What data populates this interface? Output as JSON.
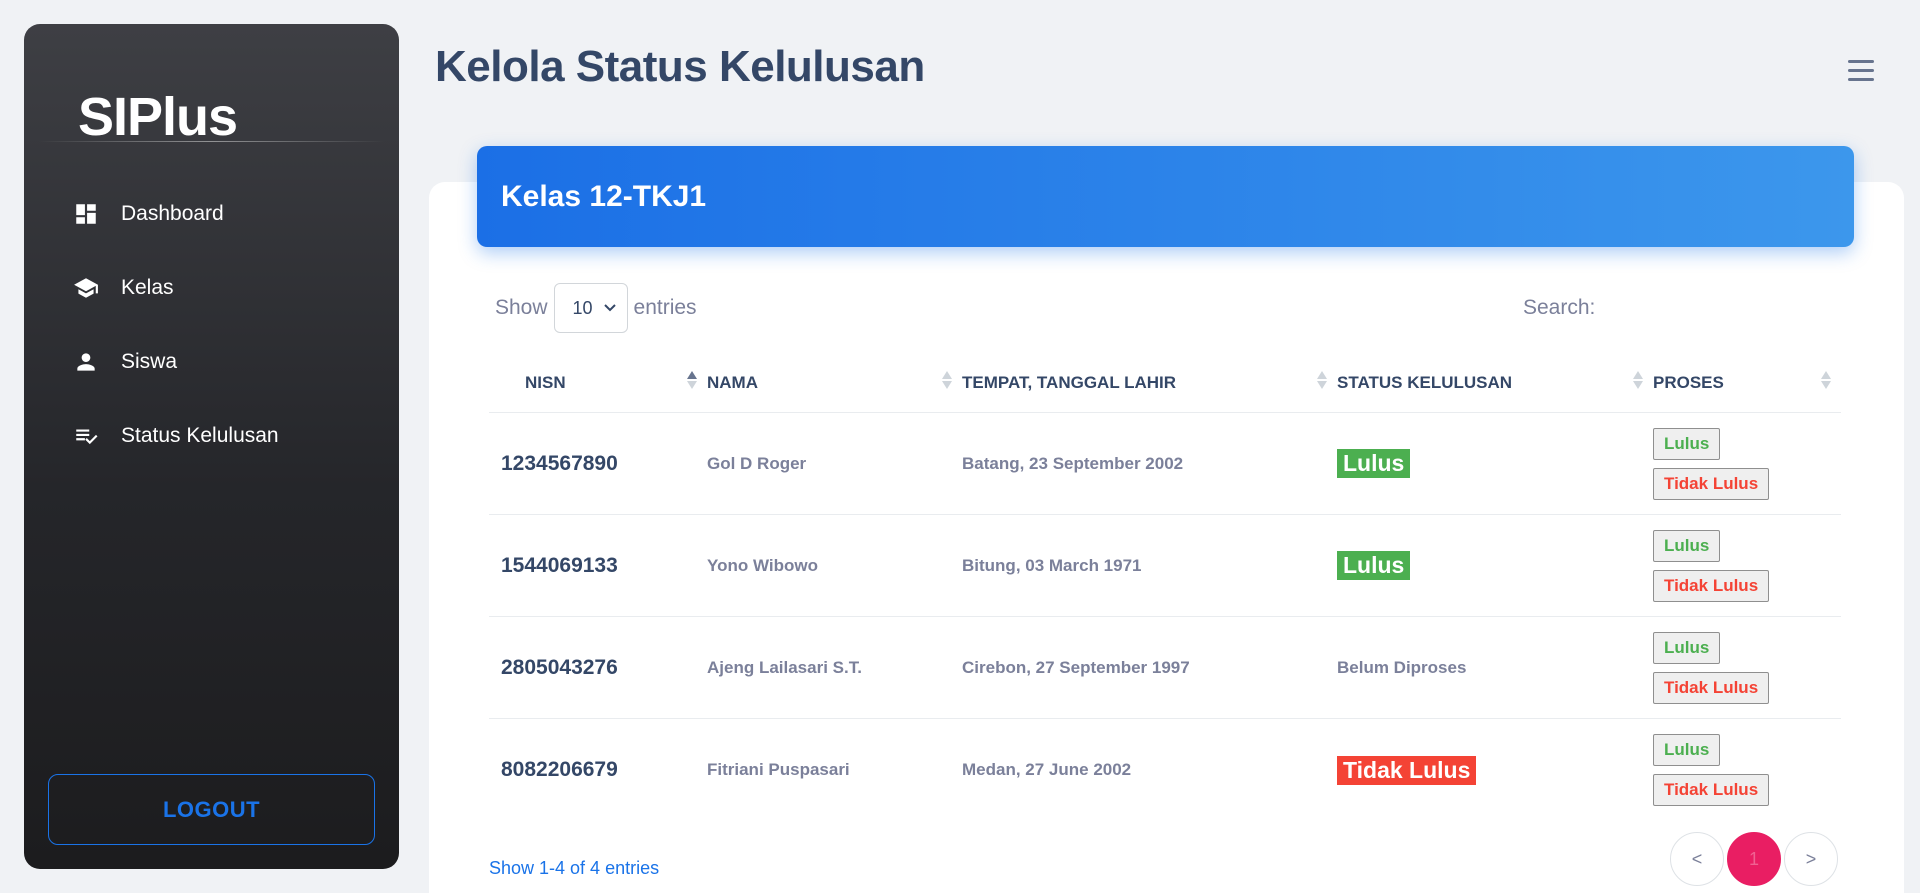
{
  "sidebar": {
    "brand": "SIPlus",
    "items": [
      {
        "label": "Dashboard",
        "icon": "dashboard-icon"
      },
      {
        "label": "Kelas",
        "icon": "school-icon"
      },
      {
        "label": "Siswa",
        "icon": "person-icon"
      },
      {
        "label": "Status Kelulusan",
        "icon": "checklist-icon"
      }
    ],
    "logout_label": "LOGOUT"
  },
  "header": {
    "title": "Kelola Status Kelulusan",
    "menu_icon": "hamburger-icon"
  },
  "card": {
    "title": "Kelas 12-TKJ1"
  },
  "controls": {
    "show_label": "Show",
    "entries_value": "10",
    "entries_label": "entries",
    "search_label": "Search:",
    "search_value": ""
  },
  "table": {
    "columns": [
      "NISN",
      "NAMA",
      "TEMPAT, TANGGAL LAHIR",
      "STATUS KELULUSAN",
      "PROSES"
    ],
    "rows": [
      {
        "nisn": "1234567890",
        "nama": "Gol D Roger",
        "ttl": "Batang, 23 September 2002",
        "status": "Lulus",
        "status_type": "lulus"
      },
      {
        "nisn": "1544069133",
        "nama": "Yono Wibowo",
        "ttl": "Bitung, 03 March 1971",
        "status": "Lulus",
        "status_type": "lulus"
      },
      {
        "nisn": "2805043276",
        "nama": "Ajeng Lailasari S.T.",
        "ttl": "Cirebon, 27 September 1997",
        "status": "Belum Diproses",
        "status_type": "pending"
      },
      {
        "nisn": "8082206679",
        "nama": "Fitriani Puspasari",
        "ttl": "Medan, 27 June 2002",
        "status": "Tidak Lulus",
        "status_type": "tidak"
      }
    ],
    "btn_lulus": "Lulus",
    "btn_tidak_lulus": "Tidak Lulus"
  },
  "footer": {
    "info": "Show 1-4 of 4 entries",
    "prev": "<",
    "page": "1",
    "next": ">"
  },
  "colors": {
    "accent": "#1a73e8",
    "success": "#4caf50",
    "danger": "#f44335",
    "pagination_active": "#e91e63"
  }
}
